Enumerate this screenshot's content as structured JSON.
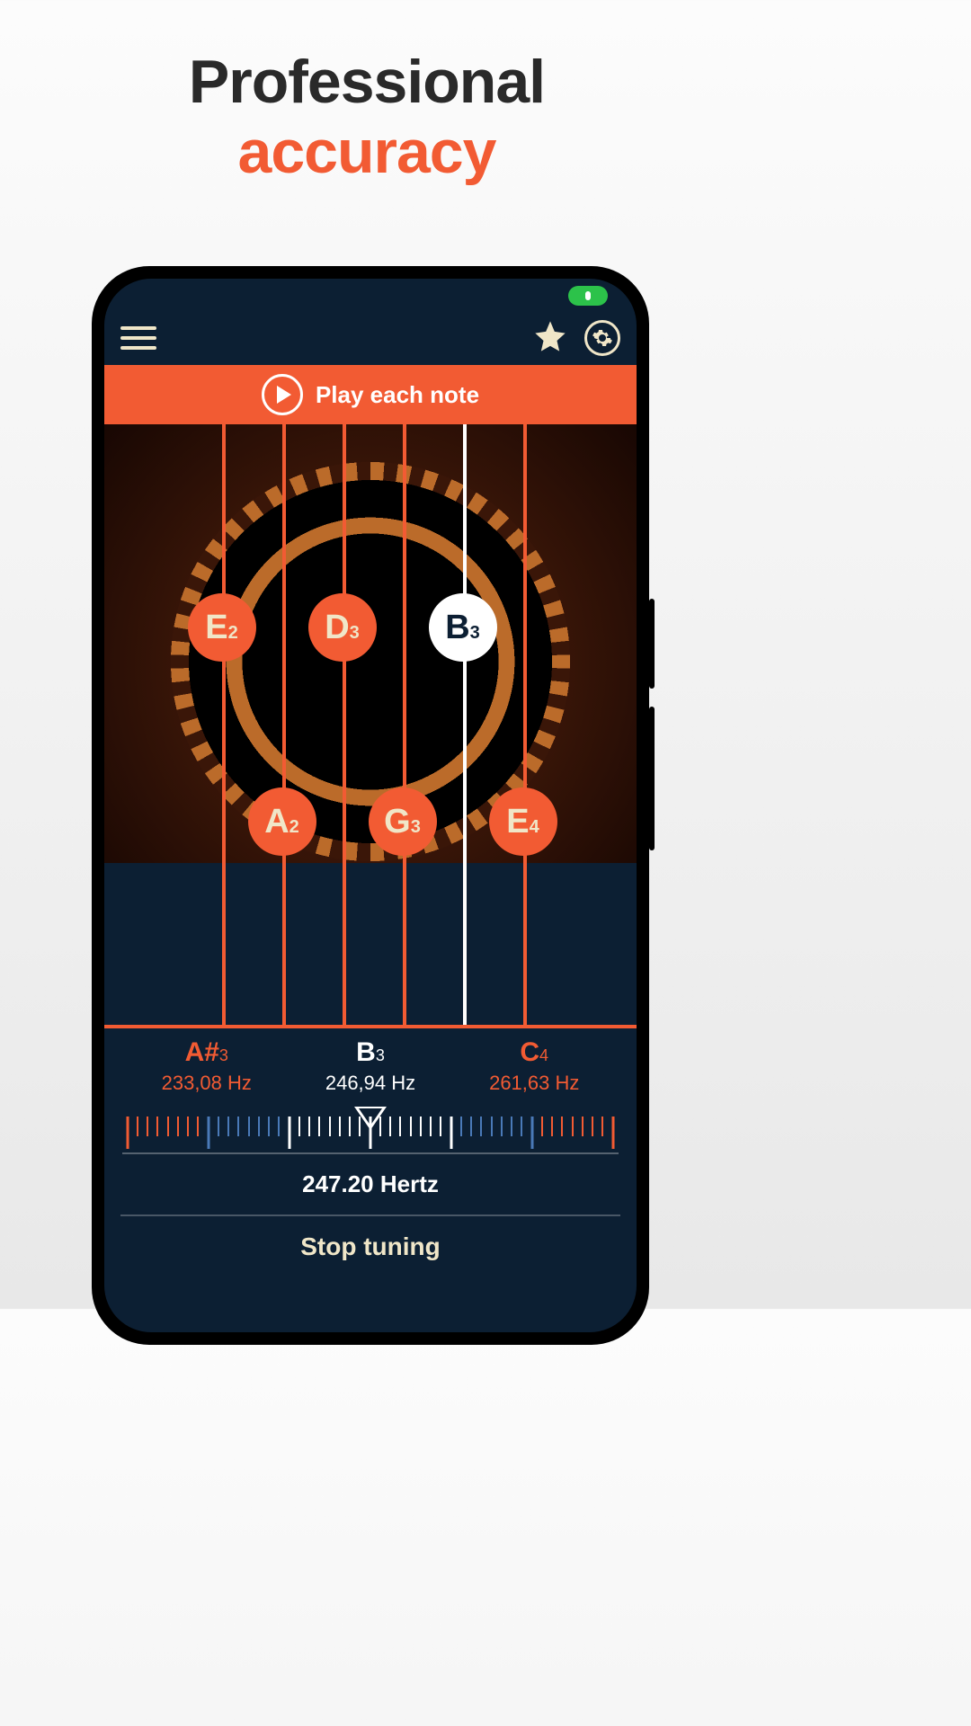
{
  "marketing": {
    "line1": "Professional",
    "line2": "accuracy"
  },
  "play_bar": {
    "label": "Play each note"
  },
  "strings": [
    {
      "row": "top",
      "pos": 1,
      "active": false,
      "letter": "E",
      "octave": "2"
    },
    {
      "row": "bot",
      "pos": 2,
      "active": false,
      "letter": "A",
      "octave": "2"
    },
    {
      "row": "top",
      "pos": 3,
      "active": false,
      "letter": "D",
      "octave": "3"
    },
    {
      "row": "bot",
      "pos": 4,
      "active": false,
      "letter": "G",
      "octave": "3"
    },
    {
      "row": "top",
      "pos": 5,
      "active": true,
      "letter": "B",
      "octave": "3"
    },
    {
      "row": "bot",
      "pos": 6,
      "active": false,
      "letter": "E",
      "octave": "4"
    }
  ],
  "freq": {
    "left": {
      "note": "A#",
      "octave": "3",
      "hz": "233,08 Hz"
    },
    "mid": {
      "note": "B",
      "octave": "3",
      "hz": "246,94 Hz"
    },
    "right": {
      "note": "C",
      "octave": "4",
      "hz": "261,63 Hz"
    }
  },
  "current_hertz": "247.20 Hertz",
  "stop_label": "Stop tuning"
}
